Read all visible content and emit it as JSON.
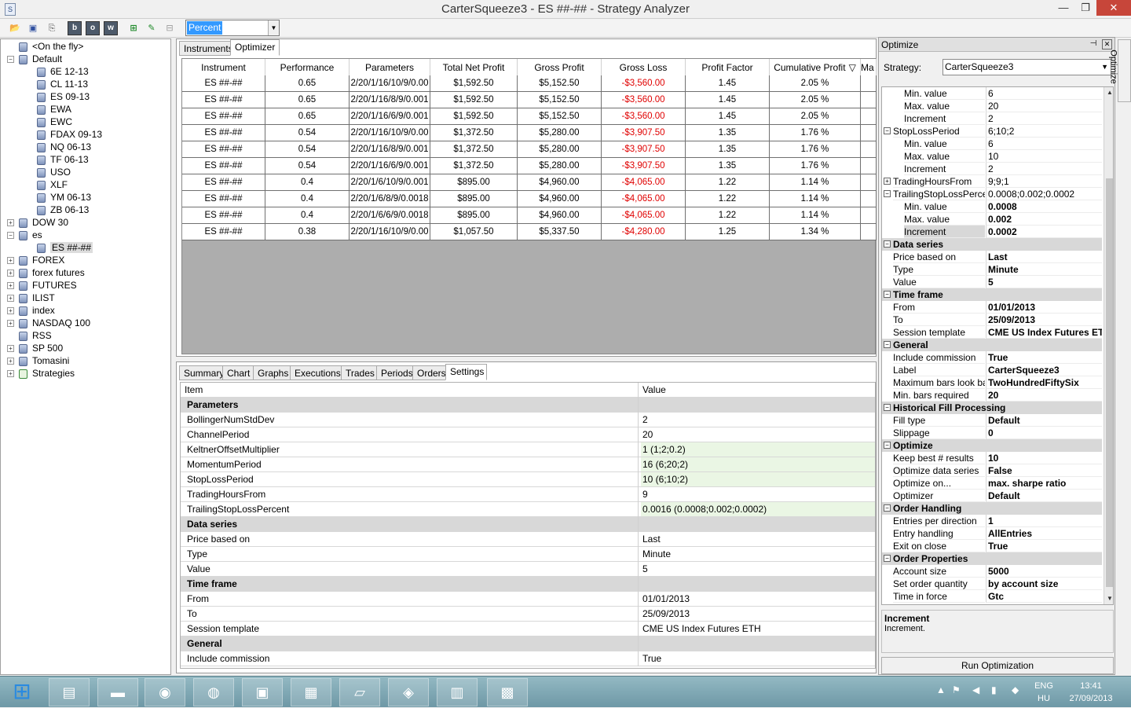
{
  "window": {
    "title": "CarterSqueeze3 - ES ##-## - Strategy Analyzer",
    "app_icon": "strategy-analyzer-icon",
    "minimize": "—",
    "maximize": "❐",
    "close": "✕"
  },
  "toolbar": {
    "icons": [
      "open-folder-icon",
      "save-icon",
      "save-as-icon",
      "b-icon",
      "o-icon",
      "w-icon",
      "add-icon",
      "edit-icon",
      "remove-icon"
    ],
    "letters": {
      "b": "b",
      "o": "o",
      "w": "w"
    },
    "display_mode": "Percent"
  },
  "tree": {
    "items": [
      {
        "label": "<On the fly>",
        "indent": 0,
        "expander": "",
        "icon": "instrument-list-icon"
      },
      {
        "label": "Default",
        "indent": 0,
        "expander": "−",
        "icon": "instrument-list-icon"
      },
      {
        "label": "6E 12-13",
        "indent": 1,
        "expander": "",
        "icon": "instrument-icon"
      },
      {
        "label": "CL 11-13",
        "indent": 1,
        "expander": "",
        "icon": "instrument-icon"
      },
      {
        "label": "ES 09-13",
        "indent": 1,
        "expander": "",
        "icon": "instrument-icon"
      },
      {
        "label": "EWA",
        "indent": 1,
        "expander": "",
        "icon": "instrument-icon"
      },
      {
        "label": "EWC",
        "indent": 1,
        "expander": "",
        "icon": "instrument-icon"
      },
      {
        "label": "FDAX 09-13",
        "indent": 1,
        "expander": "",
        "icon": "instrument-icon"
      },
      {
        "label": "NQ 06-13",
        "indent": 1,
        "expander": "",
        "icon": "instrument-icon"
      },
      {
        "label": "TF 06-13",
        "indent": 1,
        "expander": "",
        "icon": "instrument-icon"
      },
      {
        "label": "USO",
        "indent": 1,
        "expander": "",
        "icon": "instrument-icon"
      },
      {
        "label": "XLF",
        "indent": 1,
        "expander": "",
        "icon": "instrument-icon"
      },
      {
        "label": "YM 06-13",
        "indent": 1,
        "expander": "",
        "icon": "instrument-icon"
      },
      {
        "label": "ZB 06-13",
        "indent": 1,
        "expander": "",
        "icon": "instrument-icon"
      },
      {
        "label": "DOW 30",
        "indent": 0,
        "expander": "+",
        "icon": "instrument-list-icon"
      },
      {
        "label": "es",
        "indent": 0,
        "expander": "−",
        "icon": "instrument-list-icon"
      },
      {
        "label": "ES ##-##",
        "indent": 1,
        "expander": "",
        "icon": "instrument-icon",
        "selected": true
      },
      {
        "label": "FOREX",
        "indent": 0,
        "expander": "+",
        "icon": "instrument-list-icon"
      },
      {
        "label": "forex futures",
        "indent": 0,
        "expander": "+",
        "icon": "instrument-list-icon"
      },
      {
        "label": "FUTURES",
        "indent": 0,
        "expander": "+",
        "icon": "instrument-list-icon"
      },
      {
        "label": "ILIST",
        "indent": 0,
        "expander": "+",
        "icon": "instrument-list-icon"
      },
      {
        "label": "index",
        "indent": 0,
        "expander": "+",
        "icon": "instrument-list-icon"
      },
      {
        "label": "NASDAQ 100",
        "indent": 0,
        "expander": "+",
        "icon": "instrument-list-icon"
      },
      {
        "label": "RSS",
        "indent": 0,
        "expander": "",
        "icon": "instrument-list-icon"
      },
      {
        "label": "SP 500",
        "indent": 0,
        "expander": "+",
        "icon": "instrument-list-icon"
      },
      {
        "label": "Tomasini",
        "indent": 0,
        "expander": "+",
        "icon": "instrument-list-icon"
      },
      {
        "label": "Strategies",
        "indent": 0,
        "expander": "+",
        "icon": "strategies-icon"
      }
    ]
  },
  "top_tabs": [
    "Instruments",
    "Optimizer"
  ],
  "results_grid": {
    "columns": [
      "Instrument",
      "Performance",
      "Parameters",
      "Total Net Profit",
      "Gross Profit",
      "Gross Loss",
      "Profit Factor",
      "Cumulative Profit",
      "Ma"
    ],
    "sort_indicator": "▽",
    "rows": [
      [
        "ES ##-##",
        "0.65",
        "2/20/1/16/10/9/0.00",
        "$1,592.50",
        "$5,152.50",
        "-$3,560.00",
        "1.45",
        "2.05 %"
      ],
      [
        "ES ##-##",
        "0.65",
        "2/20/1/16/8/9/0.001",
        "$1,592.50",
        "$5,152.50",
        "-$3,560.00",
        "1.45",
        "2.05 %"
      ],
      [
        "ES ##-##",
        "0.65",
        "2/20/1/16/6/9/0.001",
        "$1,592.50",
        "$5,152.50",
        "-$3,560.00",
        "1.45",
        "2.05 %"
      ],
      [
        "ES ##-##",
        "0.54",
        "2/20/1/16/10/9/0.00",
        "$1,372.50",
        "$5,280.00",
        "-$3,907.50",
        "1.35",
        "1.76 %"
      ],
      [
        "ES ##-##",
        "0.54",
        "2/20/1/16/8/9/0.001",
        "$1,372.50",
        "$5,280.00",
        "-$3,907.50",
        "1.35",
        "1.76 %"
      ],
      [
        "ES ##-##",
        "0.54",
        "2/20/1/16/6/9/0.001",
        "$1,372.50",
        "$5,280.00",
        "-$3,907.50",
        "1.35",
        "1.76 %"
      ],
      [
        "ES ##-##",
        "0.4",
        "2/20/1/6/10/9/0.001",
        "$895.00",
        "$4,960.00",
        "-$4,065.00",
        "1.22",
        "1.14 %"
      ],
      [
        "ES ##-##",
        "0.4",
        "2/20/1/6/8/9/0.0018",
        "$895.00",
        "$4,960.00",
        "-$4,065.00",
        "1.22",
        "1.14 %"
      ],
      [
        "ES ##-##",
        "0.4",
        "2/20/1/6/6/9/0.0018",
        "$895.00",
        "$4,960.00",
        "-$4,065.00",
        "1.22",
        "1.14 %"
      ],
      [
        "ES ##-##",
        "0.38",
        "2/20/1/16/10/9/0.00",
        "$1,057.50",
        "$5,337.50",
        "-$4,280.00",
        "1.25",
        "1.34 %"
      ]
    ]
  },
  "bottom_tabs": [
    "Summary",
    "Chart",
    "Graphs",
    "Executions",
    "Trades",
    "Periods",
    "Orders",
    "Settings"
  ],
  "settings_table": {
    "header": {
      "item": "Item",
      "value": "Value"
    },
    "rows": [
      {
        "k": "Parameters",
        "v": "",
        "cat": true
      },
      {
        "k": "BollingerNumStdDev",
        "v": "2"
      },
      {
        "k": "ChannelPeriod",
        "v": "20"
      },
      {
        "k": "KeltnerOffsetMultiplier",
        "v": "1 (1;2;0.2)",
        "hl": true
      },
      {
        "k": "MomentumPeriod",
        "v": "16 (6;20;2)",
        "hl": true
      },
      {
        "k": "StopLossPeriod",
        "v": "10 (6;10;2)",
        "hl": true
      },
      {
        "k": "TradingHoursFrom",
        "v": "9"
      },
      {
        "k": "TrailingStopLossPercent",
        "v": "0.0016 (0.0008;0.002;0.0002)",
        "hl": true
      },
      {
        "k": "Data series",
        "v": "",
        "cat": true
      },
      {
        "k": "Price based on",
        "v": "Last"
      },
      {
        "k": "Type",
        "v": "Minute"
      },
      {
        "k": "Value",
        "v": "5"
      },
      {
        "k": "Time frame",
        "v": "",
        "cat": true
      },
      {
        "k": "From",
        "v": "01/01/2013"
      },
      {
        "k": "To",
        "v": "25/09/2013"
      },
      {
        "k": "Session template",
        "v": "CME US Index Futures ETH"
      },
      {
        "k": "General",
        "v": "",
        "cat": true
      },
      {
        "k": "Include commission",
        "v": "True"
      }
    ]
  },
  "optimize_panel": {
    "title": "Optimize",
    "strategy_label": "Strategy:",
    "strategy_value": "CarterSqueeze3",
    "side_tab": "Optimize",
    "properties": [
      {
        "k": "Min. value",
        "v": "6",
        "sub": true
      },
      {
        "k": "Max. value",
        "v": "20",
        "sub": true
      },
      {
        "k": "Increment",
        "v": "2",
        "sub": true
      },
      {
        "k": "StopLossPeriod",
        "v": "6;10;2",
        "exp": "−"
      },
      {
        "k": "Min. value",
        "v": "6",
        "sub": true
      },
      {
        "k": "Max. value",
        "v": "10",
        "sub": true
      },
      {
        "k": "Increment",
        "v": "2",
        "sub": true
      },
      {
        "k": "TradingHoursFrom",
        "v": "9;9;1",
        "exp": "+"
      },
      {
        "k": "TrailingStopLossPercent",
        "v": "0.0008;0.002;0.0002",
        "exp": "−"
      },
      {
        "k": "Min. value",
        "v": "0.0008",
        "sub": true,
        "bold": true
      },
      {
        "k": "Max. value",
        "v": "0.002",
        "sub": true,
        "bold": true
      },
      {
        "k": "Increment",
        "v": "0.0002",
        "sub": true,
        "bold": true,
        "selected": true
      },
      {
        "k": "Data series",
        "v": "",
        "cat": true
      },
      {
        "k": "Price based on",
        "v": "Last",
        "bold": true
      },
      {
        "k": "Type",
        "v": "Minute",
        "bold": true
      },
      {
        "k": "Value",
        "v": "5",
        "bold": true
      },
      {
        "k": "Time frame",
        "v": "",
        "cat": true
      },
      {
        "k": "From",
        "v": "01/01/2013",
        "bold": true
      },
      {
        "k": "To",
        "v": "25/09/2013",
        "bold": true
      },
      {
        "k": "Session template",
        "v": "CME US Index Futures ETH",
        "bold": true
      },
      {
        "k": "General",
        "v": "",
        "cat": true
      },
      {
        "k": "Include commission",
        "v": "True",
        "bold": true
      },
      {
        "k": "Label",
        "v": "CarterSqueeze3",
        "bold": true
      },
      {
        "k": "Maximum bars look back",
        "v": "TwoHundredFiftySix",
        "bold": true
      },
      {
        "k": "Min. bars required",
        "v": "20",
        "bold": true
      },
      {
        "k": "Historical Fill Processing",
        "v": "",
        "cat": true
      },
      {
        "k": "Fill type",
        "v": "Default",
        "bold": true
      },
      {
        "k": "Slippage",
        "v": "0",
        "bold": true
      },
      {
        "k": "Optimize",
        "v": "",
        "cat": true
      },
      {
        "k": "Keep best # results",
        "v": "10",
        "bold": true
      },
      {
        "k": "Optimize data series",
        "v": "False",
        "bold": true
      },
      {
        "k": "Optimize on...",
        "v": "max. sharpe ratio",
        "bold": true
      },
      {
        "k": "Optimizer",
        "v": "Default",
        "bold": true
      },
      {
        "k": "Order Handling",
        "v": "",
        "cat": true
      },
      {
        "k": "Entries per direction",
        "v": "1",
        "bold": true
      },
      {
        "k": "Entry handling",
        "v": "AllEntries",
        "bold": true
      },
      {
        "k": "Exit on close",
        "v": "True",
        "bold": true
      },
      {
        "k": "Order Properties",
        "v": "",
        "cat": true
      },
      {
        "k": "Account size",
        "v": "5000",
        "bold": true
      },
      {
        "k": "Set order quantity",
        "v": "by account size",
        "bold": true
      },
      {
        "k": "Time in force",
        "v": "Gtc",
        "bold": true
      }
    ],
    "description_title": "Increment",
    "description_text": "Increment.",
    "run_button": "Run Optimization"
  },
  "taskbar": {
    "apps": [
      "windows-start-icon",
      "file-explorer-icon",
      "command-prompt-icon",
      "chrome-icon",
      "firefox-icon",
      "remote-desktop-icon",
      "save-disk-icon",
      "notepad-icon",
      "ninjatrader-icon",
      "calculator-icon",
      "chart-monitor-icon"
    ],
    "lang_top": "ENG",
    "lang_bottom": "HU",
    "time": "13:41",
    "date": "27/09/2013"
  },
  "colors": {
    "loss": "#e00000",
    "selection": "#3399ff",
    "category_bg": "#d8d8d8",
    "highlight": "#eaf6e4"
  }
}
